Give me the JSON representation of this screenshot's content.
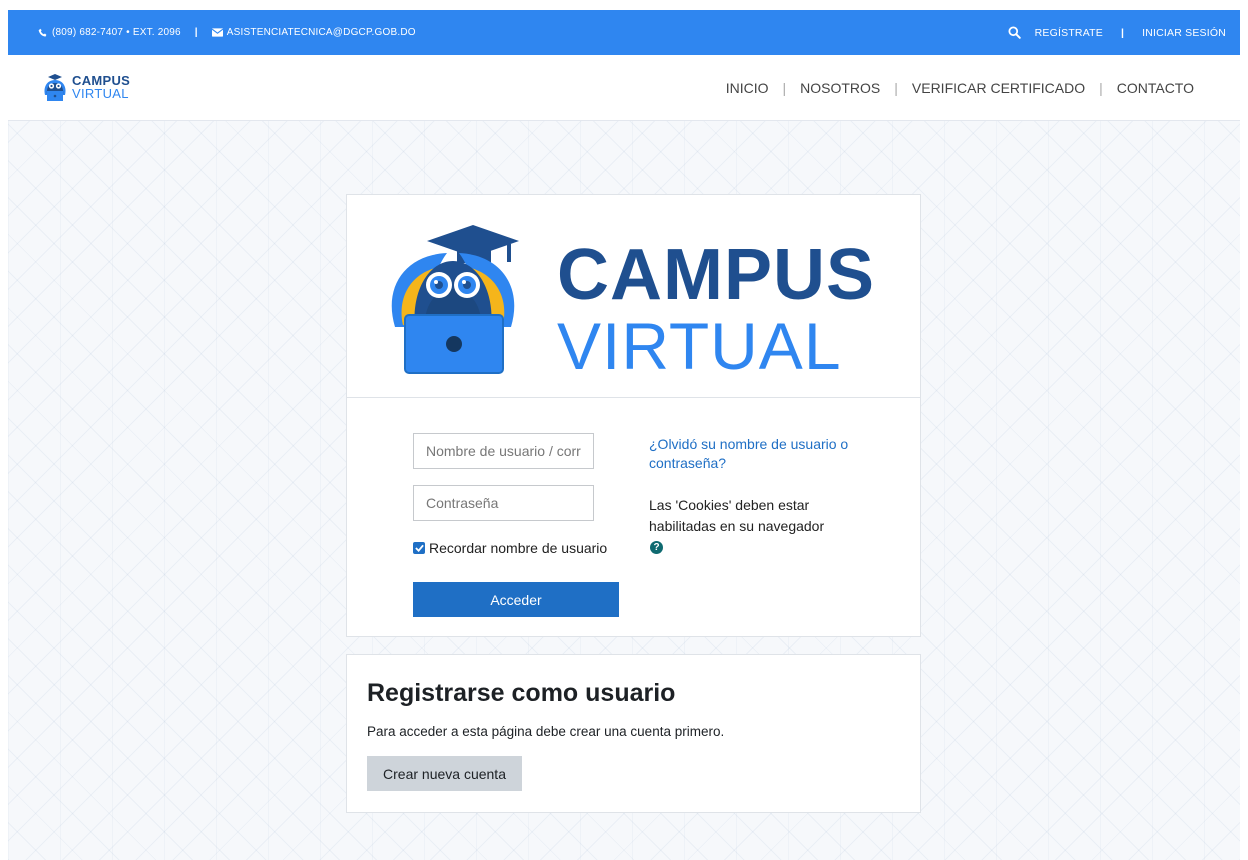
{
  "topbar": {
    "phone": "(809) 682-7407 • EXT. 2096",
    "email": "ASISTENCIATECNICA@DGCP.GOB.DO",
    "register": "REGÍSTRATE",
    "login": "INICIAR SESIÓN",
    "separator": "|"
  },
  "header": {
    "brand_line1": "CAMPUS",
    "brand_line2": "VIRTUAL",
    "nav": [
      "INICIO",
      "NOSOTROS",
      "VERIFICAR CERTIFICADO",
      "CONTACTO"
    ],
    "nav_separator": "|"
  },
  "login": {
    "logo_line1": "CAMPUS",
    "logo_line2": "VIRTUAL",
    "username_placeholder": "Nombre de usuario / correo",
    "password_placeholder": "Contraseña",
    "remember_label": "Recordar nombre de usuario",
    "remember_checked": true,
    "submit_label": "Acceder",
    "forgot_link": "¿Olvidó su nombre de usuario o contraseña?",
    "cookies_notice": "Las 'Cookies' deben estar habilitadas en su navegador",
    "help_glyph": "?"
  },
  "register": {
    "title": "Registrarse como usuario",
    "text": "Para acceder a esta página debe crear una cuenta primero.",
    "button_label": "Crear nueva cuenta"
  },
  "colors": {
    "topbar": "#2f86f0",
    "brand_dark": "#1f4f8f",
    "brand_light": "#2f86f0",
    "primary_button": "#1f6fc5",
    "secondary_button": "#ced4da"
  },
  "icons": [
    "phone-icon",
    "mail-icon",
    "search-icon",
    "owl-logo-icon",
    "check-icon",
    "help-icon"
  ]
}
